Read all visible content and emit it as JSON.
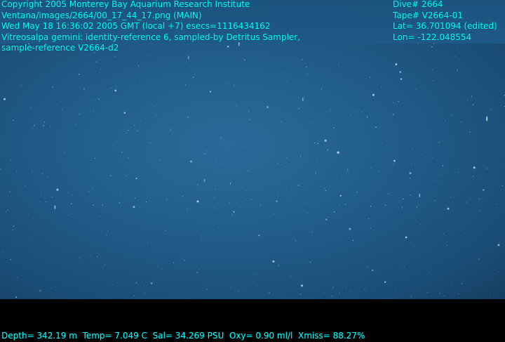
{
  "overlay": {
    "copyright": "Copyright 2005 Monterey Bay Aquarium Research Institute",
    "image_path": "Ventana/images/2664/00_17_44_17.png (MAIN)",
    "timestamp": "Wed May 18 16:36:02 2005 GMT (local +7)  esecs=1116434162",
    "annotation_line1": "Vitreosalpa gemini: identity-reference 6, sampled-by Detritus Sampler,",
    "annotation_line2": "sample-reference V2664-d2",
    "dive": "Dive# 2664",
    "tape": "Tape# V2664-01",
    "lat": "Lat= 36.701094 (edited)",
    "lon": "Lon= -122.048554",
    "sensors": {
      "depth": "Depth= 342.19 m",
      "temp": "Temp= 7.049 C",
      "salinity": "Sal= 34.269 PSU",
      "oxygen": "Oxy= 0.90 ml/l",
      "xmiss": "Xmiss= 88.27%"
    }
  },
  "colors": {
    "overlay_text": "#00ffff",
    "water": "#215c89",
    "letterbox": "#000000"
  }
}
